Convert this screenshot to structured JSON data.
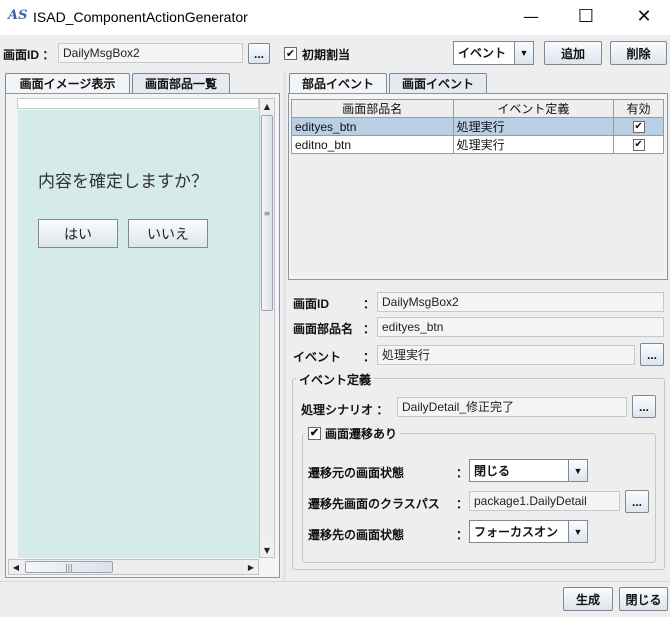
{
  "window": {
    "icon_text": "AS",
    "title": "ISAD_ComponentActionGenerator",
    "minimize": "—",
    "maximize": "☐",
    "close": "✕"
  },
  "toolbar": {
    "screen_id_label": "画面ID ：",
    "screen_id_value": "DailyMsgBox2",
    "browse_label": "...",
    "initial_assign_label": "初期割当",
    "initial_assign_checked": true,
    "event_combo_value": "イベント",
    "add_label": "追加",
    "delete_label": "削除"
  },
  "left_tabs": [
    "画面イメージ表示",
    "画面部品一覧"
  ],
  "preview": {
    "message": "内容を確定しますか？",
    "yes_label": "はい",
    "no_label": "いいえ",
    "background": "#d4ebe7"
  },
  "right_tabs": [
    "部品イベント",
    "画面イベント"
  ],
  "table": {
    "headers": [
      "画面部品名",
      "イベント定義",
      "有効"
    ],
    "rows": [
      {
        "name": "edityes_btn",
        "event": "処理実行",
        "enabled": "✔",
        "selected": true
      },
      {
        "name": "editno_btn",
        "event": "処理実行",
        "enabled": "✔",
        "selected": false
      }
    ]
  },
  "detail": {
    "screen_id_label": "画面ID",
    "screen_id_value": "DailyMsgBox2",
    "component_label": "画面部品名",
    "component_value": "edityes_btn",
    "event_label": "イベント",
    "event_value": "処理実行",
    "colon": "：",
    "browse_label": "..."
  },
  "event_def": {
    "group_title": "イベント定義",
    "scenario_label": "処理シナリオ ：",
    "scenario_value": "DailyDetail_修正完了",
    "transition_title": "画面遷移あり",
    "transition_checked": true,
    "from_state_label": "遷移元の画面状態",
    "from_state_value": "閉じる",
    "class_path_label": "遷移先画面のクラスパス",
    "class_path_value": "package1.DailyDetail",
    "to_state_label": "遷移先の画面状態",
    "to_state_value": "フォーカスオン"
  },
  "footer": {
    "generate_label": "生成",
    "close_label": "閉じる"
  }
}
